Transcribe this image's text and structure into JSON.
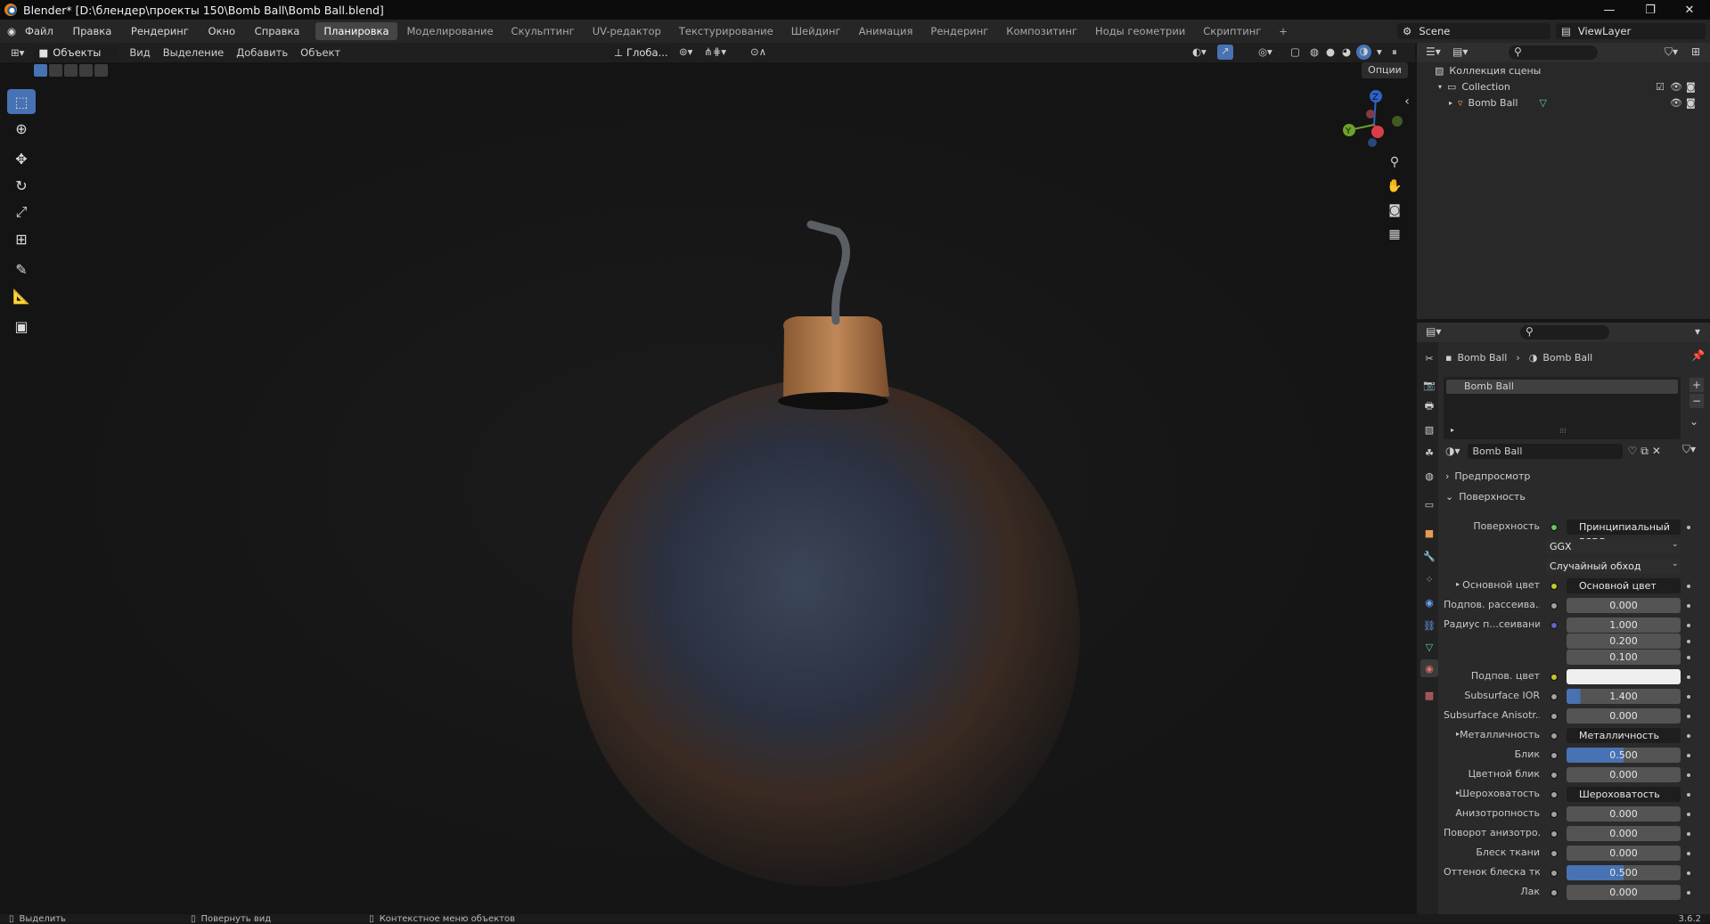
{
  "window": {
    "title": "Blender* [D:\\блендер\\проекты 150\\Bomb Ball\\Bomb Ball.blend]",
    "minimize": "—",
    "maximize": "❐",
    "close": "✕"
  },
  "menu": [
    "Файл",
    "Правка",
    "Рендеринг",
    "Окно",
    "Справка"
  ],
  "workspaces": [
    "Планировка",
    "Моделирование",
    "Скульптинг",
    "UV-редактор",
    "Текстурирование",
    "Шейдинг",
    "Анимация",
    "Рендеринг",
    "Композитинг",
    "Ноды геометрии",
    "Скриптинг"
  ],
  "workspace_add": "+",
  "scene": "Scene",
  "view_layer": "ViewLayer",
  "viewport_header": {
    "mode": "Объекты",
    "menus": [
      "Вид",
      "Выделение",
      "Добавить",
      "Объект"
    ],
    "transform_orientation": "Глоба...",
    "options": "Опции"
  },
  "gizmo": {
    "z": "Z",
    "y": "Y",
    "x": "X"
  },
  "outliner": {
    "title": "Коллекция сцены",
    "collection": "Collection",
    "object": "Bomb Ball"
  },
  "properties": {
    "breadcrumb_object": "Bomb Ball",
    "breadcrumb_material": "Bomb Ball",
    "slot": "Bomb Ball",
    "material_name": "Bomb Ball",
    "panel_preview": "Предпросмотр",
    "panel_surface": "Поверхность",
    "rows": [
      {
        "label": "Поверхность",
        "value": "Принципиальный BSDF",
        "socket": "green",
        "kind": "dark"
      },
      {
        "label": "",
        "value": "GGX",
        "socket": "",
        "kind": "dropdown"
      },
      {
        "label": "",
        "value": "Случайный обход",
        "socket": "",
        "kind": "dropdown"
      },
      {
        "label": "Основной цвет",
        "value": "Основной цвет",
        "socket": "yellow",
        "kind": "dark",
        "expand": "▸"
      },
      {
        "label": "Подпов. рассеива...",
        "value": "0.000",
        "socket": "gray",
        "kind": "num"
      },
      {
        "label": "Радиус п...сеивания",
        "value": "1.000",
        "socket": "blue",
        "kind": "num"
      },
      {
        "label": "",
        "value": "0.200",
        "socket": "",
        "kind": "num"
      },
      {
        "label": "",
        "value": "0.100",
        "socket": "",
        "kind": "num"
      },
      {
        "label": "Подпов. цвет",
        "value": "",
        "socket": "yellow",
        "kind": "white"
      },
      {
        "label": "Subsurface IOR",
        "value": "1.400",
        "socket": "gray",
        "kind": "ior"
      },
      {
        "label": "Subsurface Anisotr...",
        "value": "0.000",
        "socket": "gray",
        "kind": "num"
      },
      {
        "label": "Металличность",
        "value": "Металличность",
        "socket": "gray",
        "kind": "dark",
        "expand": "▸"
      },
      {
        "label": "Блик",
        "value": "0.500",
        "socket": "gray",
        "kind": "half"
      },
      {
        "label": "Цветной блик",
        "value": "0.000",
        "socket": "gray",
        "kind": "num"
      },
      {
        "label": "Шероховатость",
        "value": "Шероховатость",
        "socket": "gray",
        "kind": "dark",
        "expand": "▸"
      },
      {
        "label": "Анизотропность",
        "value": "0.000",
        "socket": "gray",
        "kind": "num"
      },
      {
        "label": "Поворот анизотро...",
        "value": "0.000",
        "socket": "gray",
        "kind": "num"
      },
      {
        "label": "Блеск ткани",
        "value": "0.000",
        "socket": "gray",
        "kind": "num"
      },
      {
        "label": "Оттенок блеска тк...",
        "value": "0.500",
        "socket": "gray",
        "kind": "half"
      },
      {
        "label": "Лак",
        "value": "0.000",
        "socket": "gray",
        "kind": "num"
      }
    ]
  },
  "status": {
    "select": "Выделить",
    "rotate": "Повернуть вид",
    "context": "Контекстное меню объектов",
    "version": "3.6.2"
  },
  "colors": {
    "accent": "#4772b3",
    "bg": "#161616",
    "panel": "#282828"
  }
}
